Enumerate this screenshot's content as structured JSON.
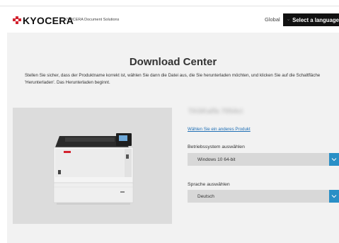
{
  "header": {
    "logo_text": "KYOCERA",
    "tagline": "KYOCERA Document Solutions",
    "global_label": "Global",
    "language_button_label": "Select a language"
  },
  "main": {
    "title": "Download Center",
    "intro": "Stellen Sie sicher, dass der Produktname korrekt ist, wählen Sie dann die Datei aus, die Sie herunterladen möchten, und klicken Sie auf die Schaltfläche 'Herunterladen'. Das Herunterladen beginnt.",
    "product_name": "TASKalfa 7054ci",
    "change_product_link": "Wählen Sie ein anderes Produkt",
    "os": {
      "label": "Betriebssystem auswählen",
      "selected": "Windows 10 64-bit"
    },
    "language": {
      "label": "Sprache auswählen",
      "selected": "Deutsch"
    }
  },
  "colors": {
    "brand_red": "#d3232f",
    "accent_blue": "#2a8fc6",
    "link_blue": "#1f6fb5",
    "header_button": "#111111"
  },
  "icons": {
    "logo_mark": "kyocera-logo-icon",
    "chevron": "chevron-down-icon",
    "product": "printer-image"
  }
}
